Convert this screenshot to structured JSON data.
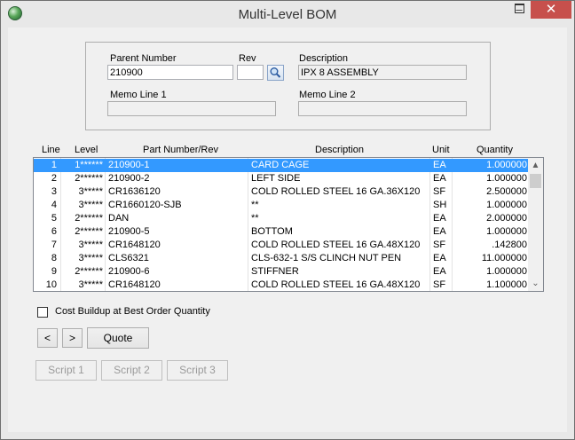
{
  "window": {
    "title": "Multi-Level BOM",
    "minimize_glyph": "‒",
    "close_glyph": "✕"
  },
  "header": {
    "parent_number_label": "Parent Number",
    "parent_number_value": "210900",
    "rev_label": "Rev",
    "rev_value": "",
    "description_label": "Description",
    "description_value": "IPX 8 ASSEMBLY",
    "memo1_label": "Memo Line 1",
    "memo1_value": "",
    "memo2_label": "Memo Line 2",
    "memo2_value": ""
  },
  "table": {
    "columns": [
      "Line",
      "Level",
      "Part Number/Rev",
      "Description",
      "Unit",
      "Quantity"
    ],
    "rows": [
      {
        "line": "1",
        "level": "1******",
        "part": "210900-1",
        "description": "CARD CAGE",
        "unit": "EA",
        "quantity": "1.000000"
      },
      {
        "line": "2",
        "level": "2******",
        "part": "210900-2",
        "description": "LEFT SIDE",
        "unit": "EA",
        "quantity": "1.000000"
      },
      {
        "line": "3",
        "level": "3*****",
        "part": "CR1636120",
        "description": "COLD ROLLED STEEL 16 GA.36X120",
        "unit": "SF",
        "quantity": "2.500000"
      },
      {
        "line": "4",
        "level": "3*****",
        "part": "CR1660120-SJB",
        "description": "**",
        "unit": "SH",
        "quantity": "1.000000"
      },
      {
        "line": "5",
        "level": "2******",
        "part": "DAN",
        "description": "**",
        "unit": "EA",
        "quantity": "2.000000"
      },
      {
        "line": "6",
        "level": "2******",
        "part": "210900-5",
        "description": "BOTTOM",
        "unit": "EA",
        "quantity": "1.000000"
      },
      {
        "line": "7",
        "level": "3*****",
        "part": "CR1648120",
        "description": "COLD ROLLED STEEL 16 GA.48X120",
        "unit": "SF",
        "quantity": ".142800"
      },
      {
        "line": "8",
        "level": "3*****",
        "part": "CLS6321",
        "description": "CLS-632-1 S/S CLINCH NUT PEN",
        "unit": "EA",
        "quantity": "11.000000"
      },
      {
        "line": "9",
        "level": "2******",
        "part": "210900-6",
        "description": "STIFFNER",
        "unit": "EA",
        "quantity": "1.000000"
      },
      {
        "line": "10",
        "level": "3*****",
        "part": "CR1648120",
        "description": "COLD ROLLED STEEL 16 GA.48X120",
        "unit": "SF",
        "quantity": "1.100000"
      }
    ],
    "selected_row": 0,
    "scroll_up_glyph": "▲",
    "scroll_down_glyph": "⌄"
  },
  "options": {
    "cost_buildup_label": "Cost Buildup at Best Order Quantity",
    "cost_buildup_checked": false
  },
  "buttons": {
    "prev": "<",
    "next": ">",
    "quote": "Quote",
    "script1": "Script 1",
    "script2": "Script 2",
    "script3": "Script 3"
  },
  "colors": {
    "selection": "#3399ff",
    "close_button": "#c7504c"
  }
}
